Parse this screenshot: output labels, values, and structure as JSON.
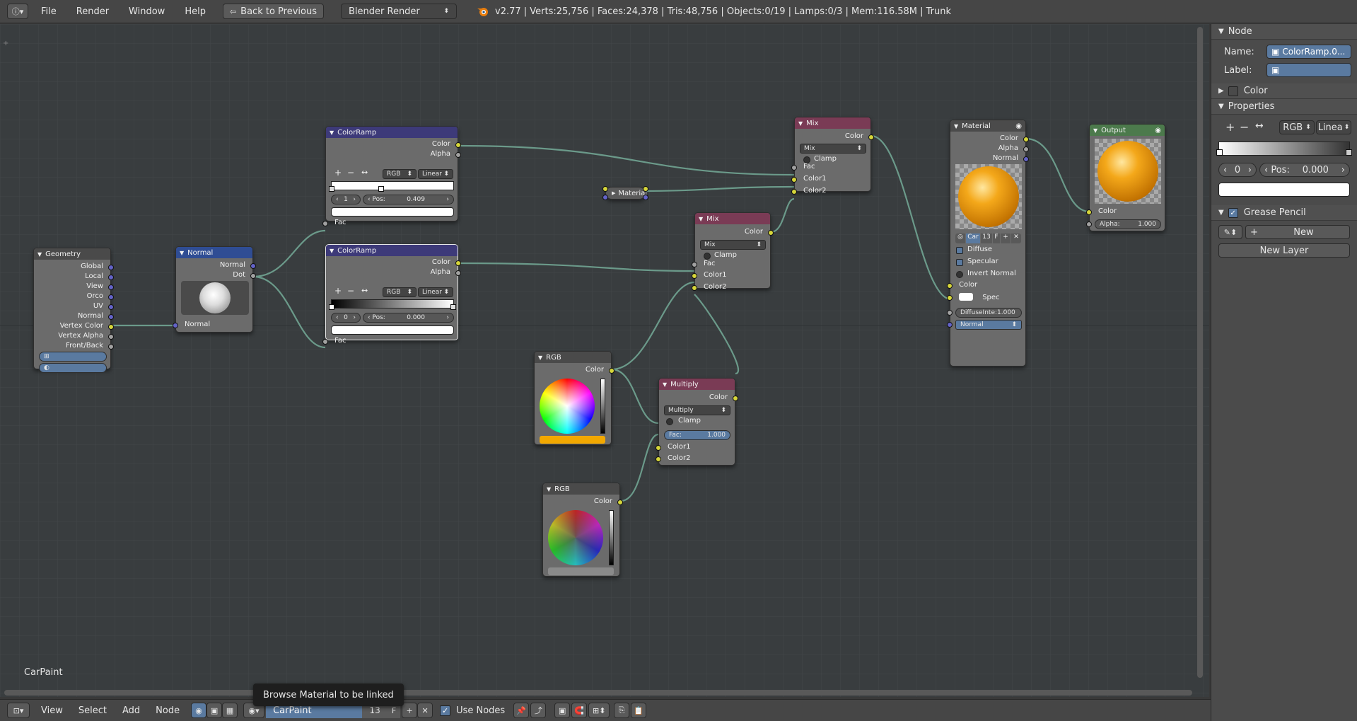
{
  "topbar": {
    "menus": [
      "File",
      "Render",
      "Window",
      "Help"
    ],
    "back_label": "Back to Previous",
    "engine": "Blender Render",
    "stats": "v2.77 | Verts:25,756 | Faces:24,378 | Tris:48,756 | Objects:0/19 | Lamps:0/3 | Mem:116.58M | Trunk"
  },
  "nodes": {
    "geometry": {
      "title": "Geometry",
      "outputs": [
        "Global",
        "Local",
        "View",
        "Orco",
        "UV",
        "Normal",
        "Vertex Color",
        "Vertex Alpha",
        "Front/Back"
      ]
    },
    "normal": {
      "title": "Normal",
      "out_normal": "Normal",
      "out_dot": "Dot",
      "in_normal": "Normal"
    },
    "colorramp1": {
      "title": "ColorRamp",
      "out_color": "Color",
      "out_alpha": "Alpha",
      "mode": "RGB",
      "interp": "Linear",
      "index": "1",
      "pos_label": "Pos:",
      "pos": "0.409",
      "in_fac": "Fac"
    },
    "colorramp2": {
      "title": "ColorRamp",
      "out_color": "Color",
      "out_alpha": "Alpha",
      "mode": "RGB",
      "interp": "Linear",
      "index": "0",
      "pos_label": "Pos:",
      "pos": "0.000",
      "in_fac": "Fac"
    },
    "material_reroute": {
      "title": "Material"
    },
    "mix1": {
      "title": "Mix",
      "out_color": "Color",
      "blend": "Mix",
      "clamp": "Clamp",
      "in_fac": "Fac",
      "in_color1": "Color1",
      "in_color2": "Color2"
    },
    "mix2": {
      "title": "Mix",
      "out_color": "Color",
      "blend": "Mix",
      "clamp": "Clamp",
      "in_fac": "Fac",
      "in_color1": "Color1",
      "in_color2": "Color2"
    },
    "rgb1": {
      "title": "RGB",
      "out_color": "Color",
      "swatch": "#f2a800"
    },
    "rgb2": {
      "title": "RGB",
      "out_color": "Color",
      "swatch": "#8a8a8a"
    },
    "multiply": {
      "title": "Multiply",
      "out_color": "Color",
      "blend": "Multiply",
      "clamp": "Clamp",
      "fac_label": "Fac:",
      "fac": "1.000",
      "in_color1": "Color1",
      "in_color2": "Color2"
    },
    "material": {
      "title": "Material",
      "out_color": "Color",
      "out_alpha": "Alpha",
      "out_normal": "Normal",
      "mat_name": "Car",
      "mat_users": "13",
      "fake": "F",
      "diffuse": "Diffuse",
      "specular": "Specular",
      "invert_normal": "Invert Normal",
      "in_color": "Color",
      "in_spec": "Spec",
      "diffuse_int": "DiffuseInte:1.000",
      "in_normal": "Normal"
    },
    "output": {
      "title": "Output",
      "in_color": "Color",
      "alpha_label": "Alpha:",
      "alpha": "1.000"
    }
  },
  "props": {
    "node_header": "Node",
    "name_label": "Name:",
    "name_value": "ColorRamp.0...",
    "label_label": "Label:",
    "color_header": "Color",
    "properties_header": "Properties",
    "mode": "RGB",
    "interp": "Linea",
    "index": "0",
    "pos_label": "Pos:",
    "pos": "0.000",
    "grease_header": "Grease Pencil",
    "new_label": "New",
    "new_layer_label": "New Layer"
  },
  "bottombar": {
    "menus": [
      "View",
      "Select",
      "Add",
      "Node"
    ],
    "material_name": "CarPaint",
    "users": "13",
    "fake": "F",
    "use_nodes": "Use Nodes"
  },
  "tooltip": "Browse Material to be linked",
  "editor_material_label": "CarPaint"
}
